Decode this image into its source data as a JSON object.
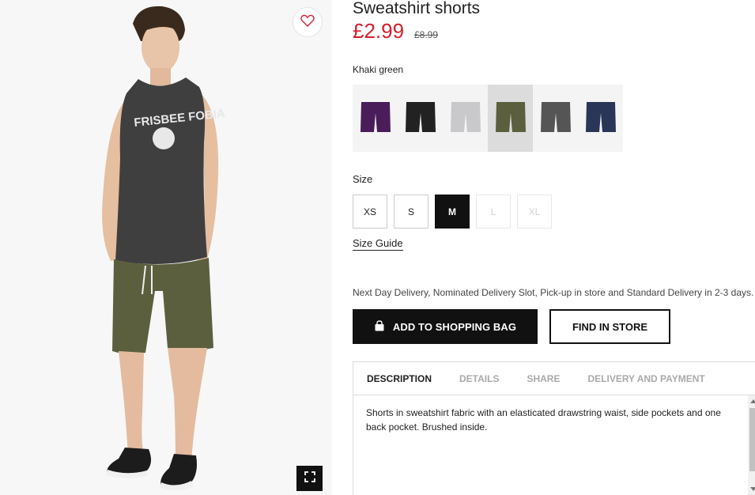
{
  "product": {
    "title": "Sweatshirt shorts",
    "price": "£2.99",
    "old_price": "£8.99",
    "selected_color": "Khaki green"
  },
  "swatches": [
    {
      "name": "purple",
      "color": "#4a1c5a"
    },
    {
      "name": "black",
      "color": "#222222"
    },
    {
      "name": "light grey",
      "color": "#c9c9cc"
    },
    {
      "name": "khaki green",
      "color": "#5b5f3e"
    },
    {
      "name": "dark grey",
      "color": "#555555"
    },
    {
      "name": "navy",
      "color": "#2a3658"
    }
  ],
  "size": {
    "label": "Size",
    "options": [
      "XS",
      "S",
      "M",
      "L",
      "XL"
    ],
    "selected": "M",
    "guide_label": "Size Guide"
  },
  "delivery_note": "Next Day Delivery, Nominated Delivery Slot, Pick-up in store and Standard Delivery in 2-3 days.",
  "actions": {
    "add_to_bag": "ADD TO SHOPPING BAG",
    "find_in_store": "FIND IN STORE"
  },
  "tabs": [
    "DESCRIPTION",
    "DETAILS",
    "SHARE",
    "DELIVERY AND PAYMENT"
  ],
  "description": "Shorts in sweatshirt fabric with an elasticated drawstring waist, side pockets and one back pocket. Brushed inside.",
  "image": {
    "tank_print": "FRISBEE FOBIA"
  },
  "colors": {
    "price": "#d0202e",
    "button_bg": "#111111"
  },
  "icons": {
    "favorite": "heart-icon",
    "fullscreen": "expand-icon",
    "bag": "shopping-bag-icon"
  }
}
